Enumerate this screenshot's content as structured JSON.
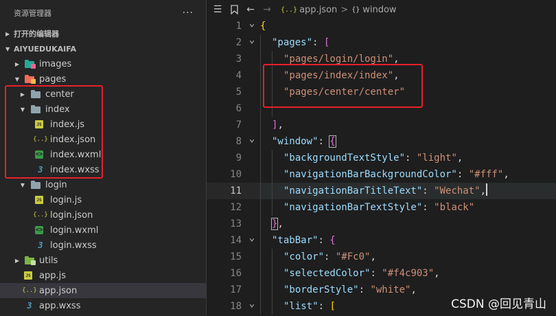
{
  "sidebar": {
    "title": "资源管理器",
    "more": "···",
    "sections": {
      "open_editors": "打开的编辑器",
      "project": "AIYUEDUKAIFA"
    },
    "tree": [
      {
        "label": "images",
        "icon": "images-folder-icon",
        "twisty": "collapsed",
        "level": 1
      },
      {
        "label": "pages",
        "icon": "pages-folder-icon",
        "twisty": "expanded",
        "level": 1
      },
      {
        "label": "center",
        "icon": "folder-icon",
        "twisty": "collapsed",
        "level": 2
      },
      {
        "label": "index",
        "icon": "folder-open-icon",
        "twisty": "expanded",
        "level": 2
      },
      {
        "label": "index.js",
        "icon": "js-file-icon",
        "level": 3
      },
      {
        "label": "index.json",
        "icon": "json-file-icon",
        "level": 3
      },
      {
        "label": "index.wxml",
        "icon": "wxml-file-icon",
        "level": 3
      },
      {
        "label": "index.wxss",
        "icon": "wxss-file-icon",
        "level": 3
      },
      {
        "label": "login",
        "icon": "folder-open-icon",
        "twisty": "expanded",
        "level": 2
      },
      {
        "label": "login.js",
        "icon": "js-file-icon",
        "level": 3
      },
      {
        "label": "login.json",
        "icon": "json-file-icon",
        "level": 3
      },
      {
        "label": "login.wxml",
        "icon": "wxml-file-icon",
        "level": 3
      },
      {
        "label": "login.wxss",
        "icon": "wxss-file-icon",
        "level": 3
      },
      {
        "label": "utils",
        "icon": "utils-folder-icon",
        "twisty": "collapsed",
        "level": 1
      },
      {
        "label": "app.js",
        "icon": "js-file-icon",
        "level": 1
      },
      {
        "label": "app.json",
        "icon": "json-file-icon",
        "level": 1,
        "selected": true
      },
      {
        "label": "app.wxss",
        "icon": "wxss-file-icon",
        "level": 1
      }
    ]
  },
  "editor": {
    "breadcrumb": {
      "file": "app.json",
      "separator": ">",
      "symbol": "window",
      "file_icon": "{..}",
      "symbol_icon": "{}"
    },
    "active_line": 11,
    "lines": [
      {
        "n": "1",
        "fold": "expanded",
        "indent": 0,
        "tokens": [
          {
            "t": "{",
            "c": "br"
          }
        ]
      },
      {
        "n": "2",
        "fold": "expanded",
        "indent": 1,
        "tokens": [
          {
            "t": "\"pages\"",
            "c": "key"
          },
          {
            "t": ": ",
            "c": "p"
          },
          {
            "t": "[",
            "c": "br2"
          }
        ]
      },
      {
        "n": "3",
        "indent": 2,
        "tokens": [
          {
            "t": "\"pages/login/login\"",
            "c": "str"
          },
          {
            "t": ",",
            "c": "p"
          }
        ]
      },
      {
        "n": "4",
        "indent": 2,
        "tokens": [
          {
            "t": "\"pages/index/index\"",
            "c": "str"
          },
          {
            "t": ",",
            "c": "p"
          }
        ]
      },
      {
        "n": "5",
        "indent": 2,
        "tokens": [
          {
            "t": "\"pages/center/center\"",
            "c": "str"
          }
        ]
      },
      {
        "n": "6",
        "indent": 2,
        "tokens": []
      },
      {
        "n": "7",
        "indent": 1,
        "tokens": [
          {
            "t": "]",
            "c": "br2"
          },
          {
            "t": ",",
            "c": "p"
          }
        ]
      },
      {
        "n": "8",
        "fold": "expanded",
        "indent": 1,
        "tokens": [
          {
            "t": "\"window\"",
            "c": "key"
          },
          {
            "t": ": ",
            "c": "p"
          },
          {
            "t": "{",
            "c": "br2",
            "box": true
          }
        ]
      },
      {
        "n": "9",
        "indent": 2,
        "tokens": [
          {
            "t": "\"backgroundTextStyle\"",
            "c": "key"
          },
          {
            "t": ": ",
            "c": "p"
          },
          {
            "t": "\"light\"",
            "c": "str"
          },
          {
            "t": ",",
            "c": "p"
          }
        ]
      },
      {
        "n": "10",
        "indent": 2,
        "tokens": [
          {
            "t": "\"navigationBarBackgroundColor\"",
            "c": "key"
          },
          {
            "t": ": ",
            "c": "p"
          },
          {
            "t": "\"#fff\"",
            "c": "str"
          },
          {
            "t": ",",
            "c": "p"
          }
        ]
      },
      {
        "n": "11",
        "indent": 2,
        "tokens": [
          {
            "t": "\"navigationBarTitleText\"",
            "c": "key"
          },
          {
            "t": ": ",
            "c": "p"
          },
          {
            "t": "\"Wechat\"",
            "c": "str"
          },
          {
            "t": ",",
            "c": "p"
          }
        ],
        "cursor": true
      },
      {
        "n": "12",
        "indent": 2,
        "tokens": [
          {
            "t": "\"navigationBarTextStyle\"",
            "c": "key"
          },
          {
            "t": ": ",
            "c": "p"
          },
          {
            "t": "\"black\"",
            "c": "str"
          }
        ]
      },
      {
        "n": "13",
        "indent": 1,
        "tokens": [
          {
            "t": "}",
            "c": "br2",
            "box": true
          },
          {
            "t": ",",
            "c": "p"
          }
        ]
      },
      {
        "n": "14",
        "fold": "expanded",
        "indent": 1,
        "tokens": [
          {
            "t": "\"tabBar\"",
            "c": "key"
          },
          {
            "t": ": ",
            "c": "p"
          },
          {
            "t": "{",
            "c": "br2"
          }
        ]
      },
      {
        "n": "15",
        "indent": 2,
        "tokens": [
          {
            "t": "\"color\"",
            "c": "key"
          },
          {
            "t": ": ",
            "c": "p"
          },
          {
            "t": "\"#Fc0\"",
            "c": "str"
          },
          {
            "t": ",",
            "c": "p"
          }
        ]
      },
      {
        "n": "16",
        "indent": 2,
        "tokens": [
          {
            "t": "\"selectedColor\"",
            "c": "key"
          },
          {
            "t": ": ",
            "c": "p"
          },
          {
            "t": "\"#f4c903\"",
            "c": "str"
          },
          {
            "t": ",",
            "c": "p"
          }
        ]
      },
      {
        "n": "17",
        "indent": 2,
        "tokens": [
          {
            "t": "\"borderStyle\"",
            "c": "key"
          },
          {
            "t": ": ",
            "c": "p"
          },
          {
            "t": "\"white\"",
            "c": "str"
          },
          {
            "t": ",",
            "c": "p"
          }
        ]
      },
      {
        "n": "18",
        "fold": "expanded",
        "indent": 2,
        "tokens": [
          {
            "t": "\"list\"",
            "c": "key"
          },
          {
            "t": ": ",
            "c": "p"
          },
          {
            "t": "[",
            "c": "br"
          }
        ]
      }
    ]
  },
  "watermark": "CSDN @回见青山",
  "colors": {
    "highlight_box": "#e8202a",
    "string": "#ce9178",
    "key": "#9cdcfe",
    "bracket_gold": "#ffd700",
    "bracket_purple": "#da70d6"
  }
}
